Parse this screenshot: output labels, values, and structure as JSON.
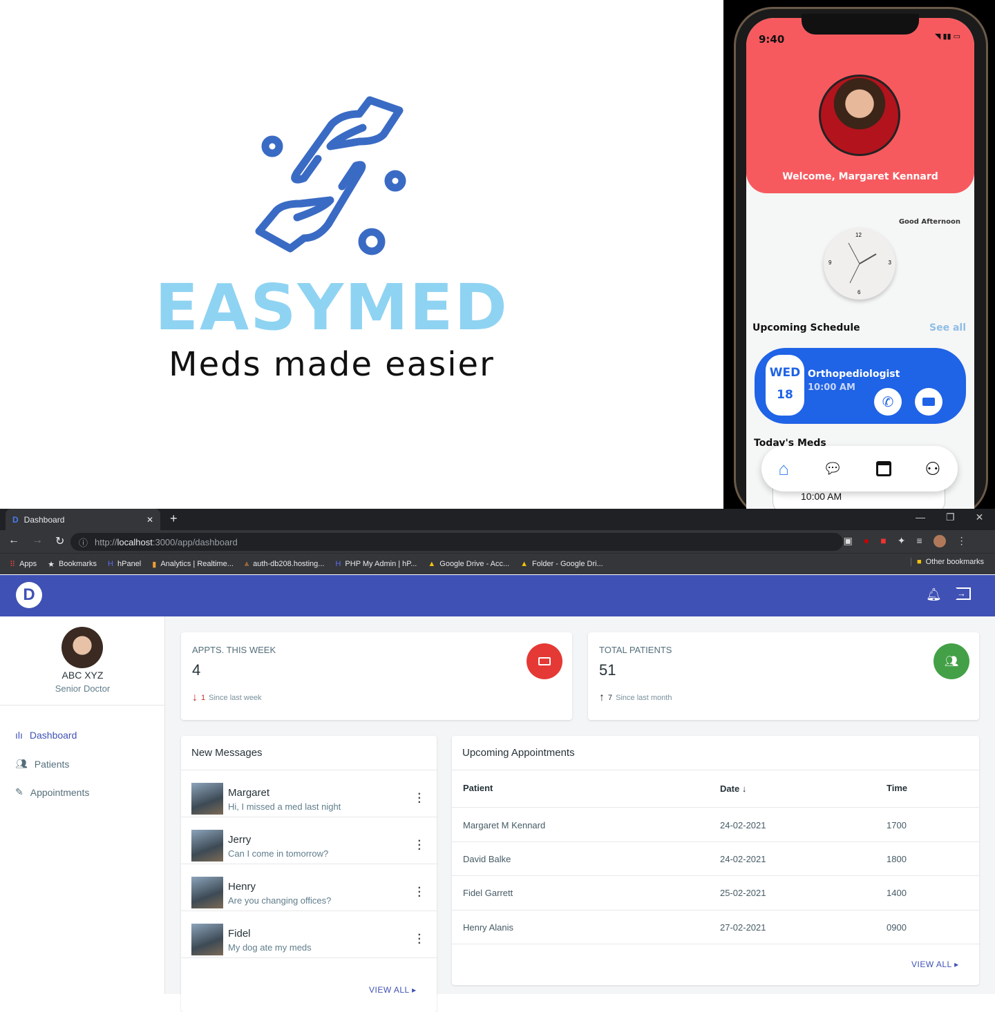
{
  "logo": {
    "brand": "EASYMED",
    "tagline": "Meds made easier",
    "color": "#8fd3f2",
    "icon_color": "#3a6bc4"
  },
  "phone": {
    "time": "9:40",
    "welcome": "Welcome, Margaret Kennard",
    "greeting": "Good Afternoon",
    "clock_numbers": [
      "12",
      "3",
      "6",
      "9"
    ],
    "section": "Upcoming Schedule",
    "see_all": "See all",
    "schedule": {
      "day": "WED",
      "date": "18",
      "title": "Orthopediologist",
      "time": "10:00 AM"
    },
    "todays_meds": "Today's Meds",
    "med_time": "10:00 AM",
    "header_color": "#f65a5f",
    "accent": "#1f63e6",
    "nav": [
      "home-icon",
      "chat-icon",
      "calendar-icon",
      "profile-icon"
    ]
  },
  "browser": {
    "tab_title": "Dashboard",
    "url_prefix": "http://",
    "url_host": "localhost",
    "url_rest": ":3000/app/dashboard",
    "bookmarks": [
      "Apps",
      "Bookmarks",
      "hPanel",
      "Analytics | Realtime...",
      "auth-db208.hosting...",
      "PHP My Admin | hP...",
      "Google Drive - Acc...",
      "Folder - Google Dri..."
    ],
    "other_bookmarks": "Other bookmarks"
  },
  "app": {
    "bar_color": "#3f51b5",
    "user": {
      "name": "ABC XYZ",
      "role": "Senior Doctor"
    },
    "nav": [
      {
        "label": "Dashboard",
        "icon": "bar-chart-icon",
        "active": true
      },
      {
        "label": "Patients",
        "icon": "users-icon"
      },
      {
        "label": "Appointments",
        "icon": "pencil-icon"
      }
    ],
    "stats": [
      {
        "title": "APPTS. THIS WEEK",
        "value": "4",
        "delta": "1",
        "direction": "down",
        "since": "Since last week",
        "color": "#e53935"
      },
      {
        "title": "TOTAL PATIENTS",
        "value": "51",
        "delta": "7",
        "direction": "up",
        "since": "Since last month",
        "color": "#43a047"
      }
    ],
    "messages": {
      "title": "New Messages",
      "items": [
        {
          "name": "Margaret",
          "text": "Hi, I missed a med last night"
        },
        {
          "name": "Jerry",
          "text": "Can I come in tomorrow?"
        },
        {
          "name": "Henry",
          "text": "Are you changing offices?"
        },
        {
          "name": "Fidel",
          "text": "My dog ate my meds"
        }
      ],
      "view_all": "VIEW ALL"
    },
    "appointments": {
      "title": "Upcoming Appointments",
      "columns": [
        "Patient",
        "Date",
        "Time"
      ],
      "rows": [
        [
          "Margaret M Kennard",
          "24-02-2021",
          "1700"
        ],
        [
          "David Balke",
          "24-02-2021",
          "1800"
        ],
        [
          "Fidel Garrett",
          "25-02-2021",
          "1400"
        ],
        [
          "Henry Alanis",
          "27-02-2021",
          "0900"
        ]
      ],
      "view_all": "VIEW ALL"
    }
  }
}
